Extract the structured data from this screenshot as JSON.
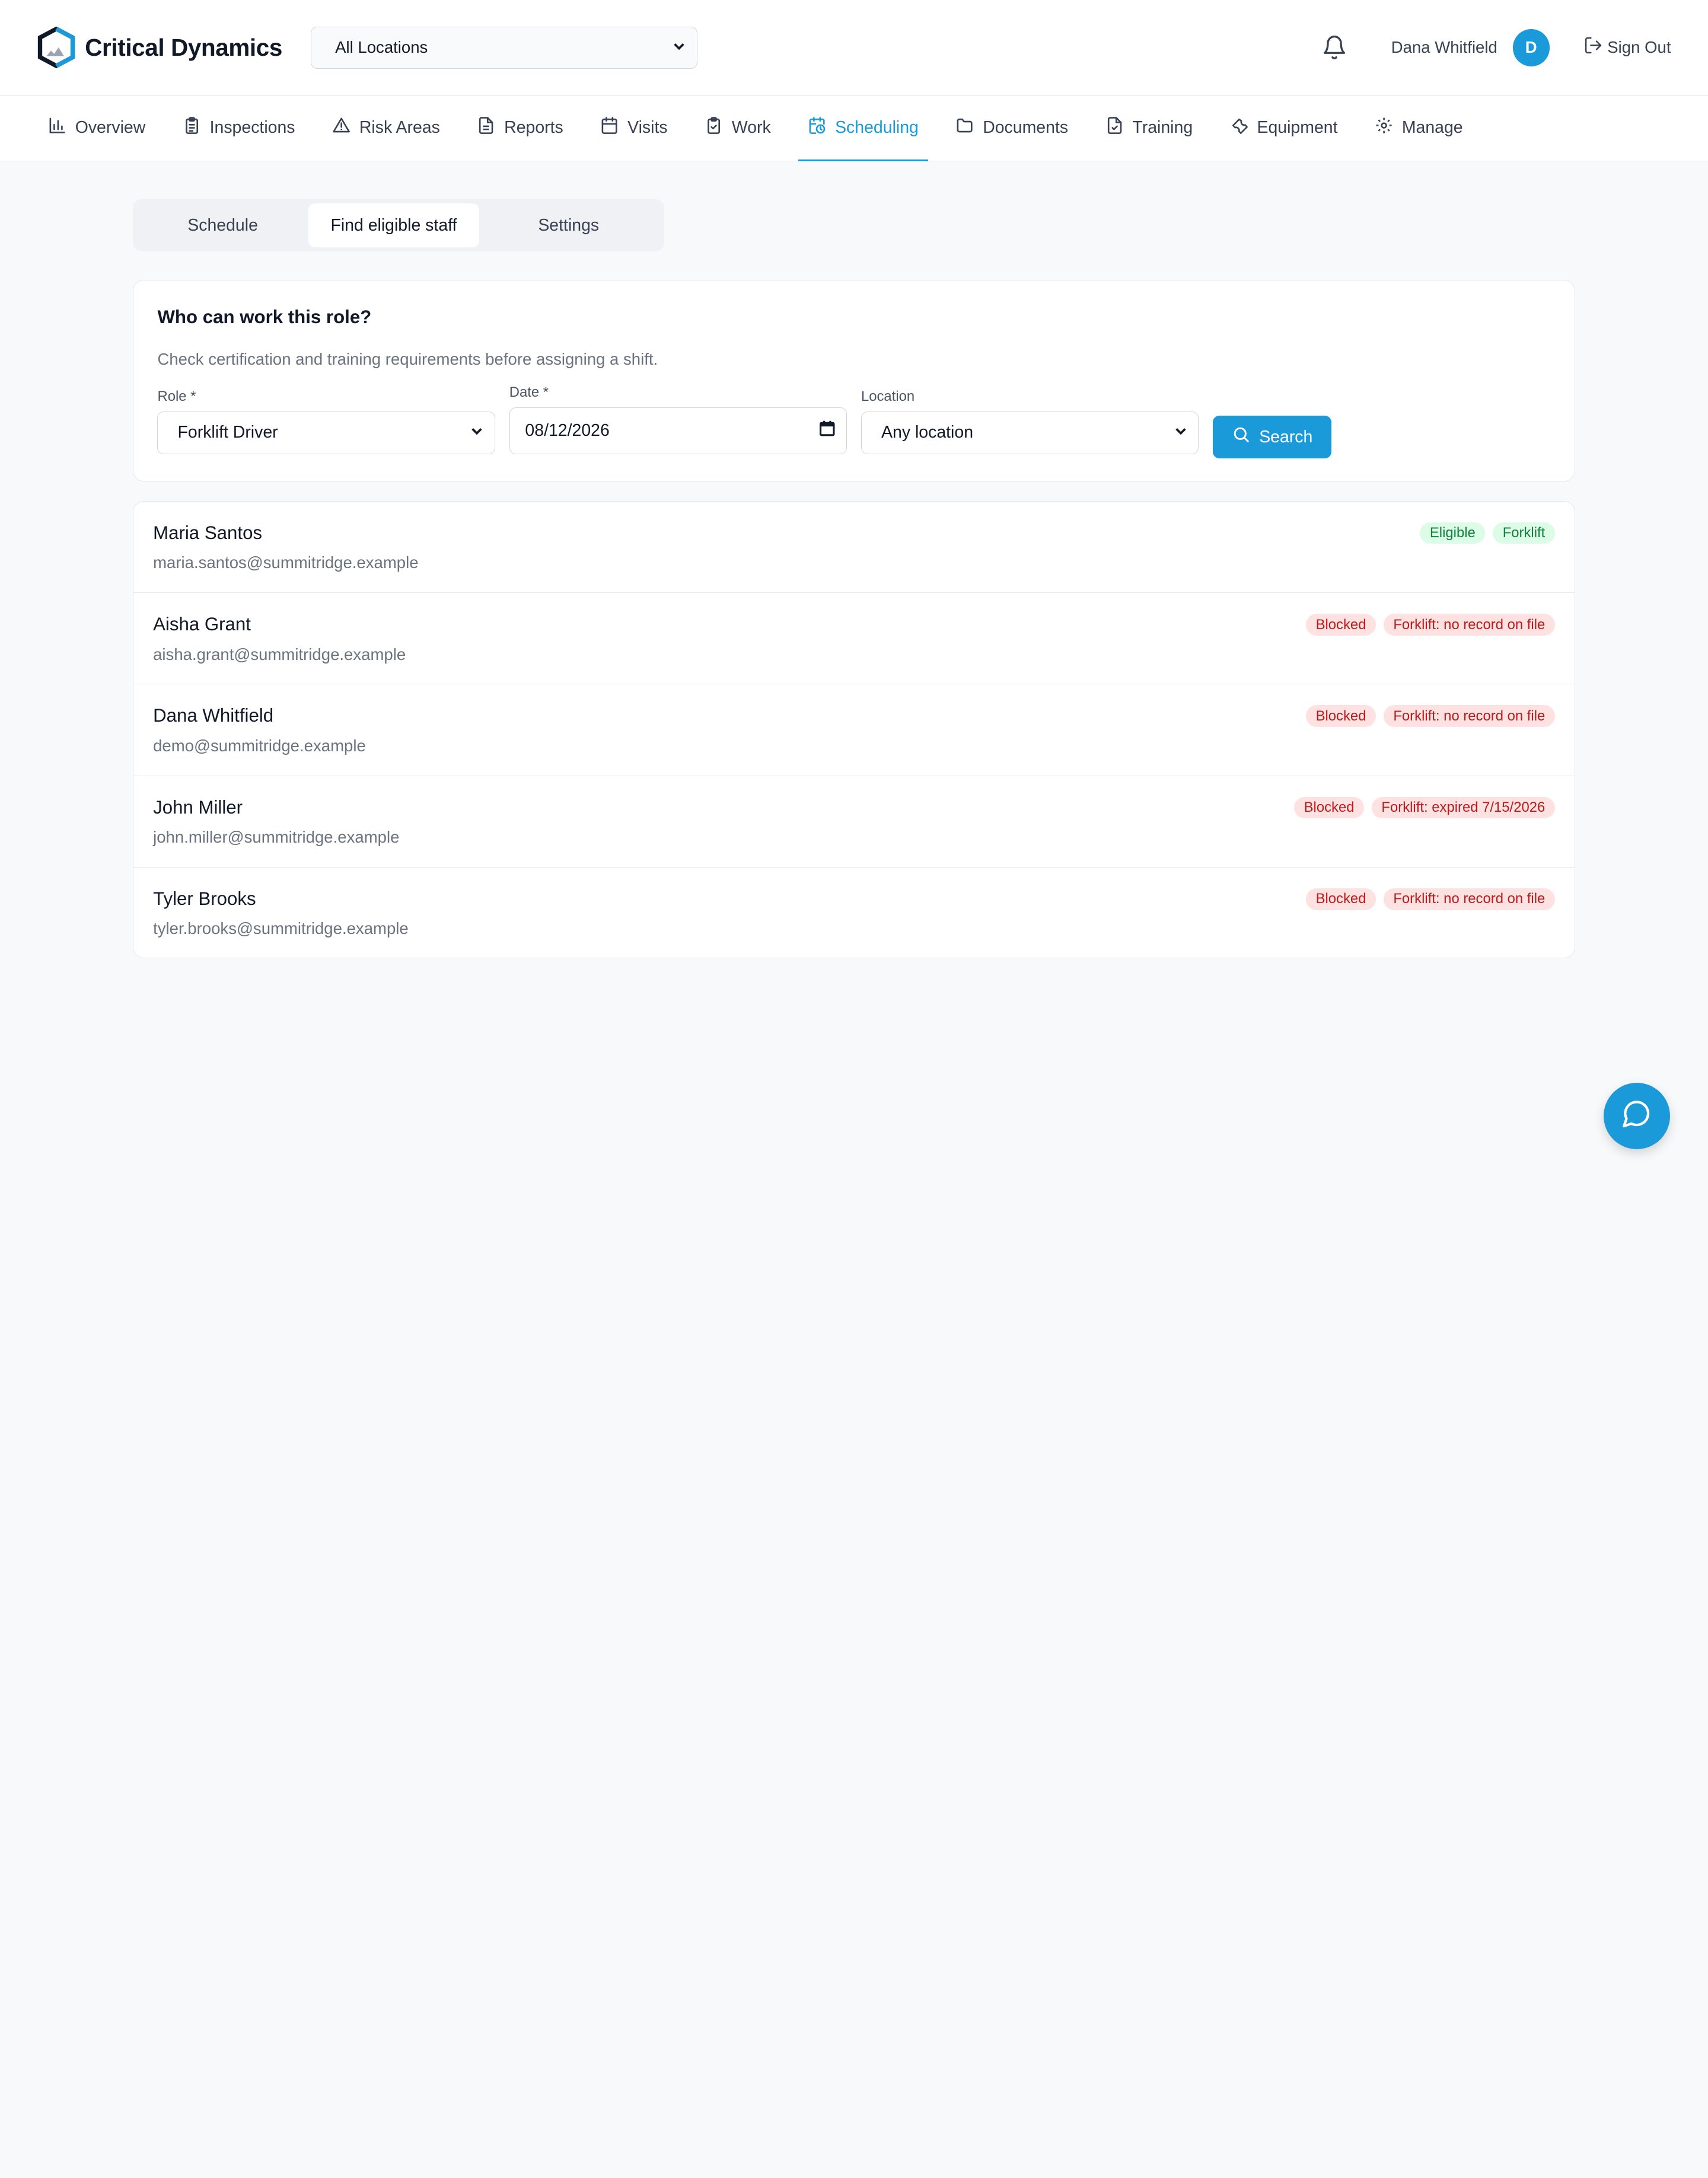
{
  "header": {
    "app_name": "Critical Dynamics",
    "location_select": "All Locations",
    "user_name": "Dana Whitfield",
    "avatar_initial": "D",
    "sign_out": "Sign Out"
  },
  "nav": [
    {
      "label": "Overview",
      "icon": "bar-chart-icon"
    },
    {
      "label": "Inspections",
      "icon": "clipboard-list-icon"
    },
    {
      "label": "Risk Areas",
      "icon": "warning-triangle-icon"
    },
    {
      "label": "Reports",
      "icon": "file-text-icon"
    },
    {
      "label": "Visits",
      "icon": "calendar-icon"
    },
    {
      "label": "Work",
      "icon": "clipboard-check-icon"
    },
    {
      "label": "Scheduling",
      "icon": "calendar-clock-icon",
      "active": true
    },
    {
      "label": "Documents",
      "icon": "folder-icon"
    },
    {
      "label": "Training",
      "icon": "file-check-icon"
    },
    {
      "label": "Equipment",
      "icon": "wrench-icon"
    },
    {
      "label": "Manage",
      "icon": "gear-icon"
    }
  ],
  "subtabs": {
    "schedule": "Schedule",
    "find": "Find eligible staff",
    "settings": "Settings"
  },
  "search": {
    "title": "Who can work this role?",
    "subtitle": "Check certification and training requirements before assigning a shift.",
    "role_label": "Role *",
    "role_value": "Forklift Driver",
    "date_label": "Date *",
    "date_value": "08/12/2026",
    "location_label": "Location",
    "location_value": "Any location",
    "button": "Search"
  },
  "results": [
    {
      "name": "Maria Santos",
      "email": "maria.santos@summitridge.example",
      "status": "Eligible",
      "detail": "Forklift",
      "tone": "green"
    },
    {
      "name": "Aisha Grant",
      "email": "aisha.grant@summitridge.example",
      "status": "Blocked",
      "detail": "Forklift: no record on file",
      "tone": "red"
    },
    {
      "name": "Dana Whitfield",
      "email": "demo@summitridge.example",
      "status": "Blocked",
      "detail": "Forklift: no record on file",
      "tone": "red"
    },
    {
      "name": "John Miller",
      "email": "john.miller@summitridge.example",
      "status": "Blocked",
      "detail": "Forklift: expired 7/15/2026",
      "tone": "red"
    },
    {
      "name": "Tyler Brooks",
      "email": "tyler.brooks@summitridge.example",
      "status": "Blocked",
      "detail": "Forklift: no record on file",
      "tone": "red"
    }
  ],
  "colors": {
    "accent": "#1a9ad8",
    "eligible_bg": "#dcfce7",
    "blocked_bg": "#fee2e2"
  }
}
